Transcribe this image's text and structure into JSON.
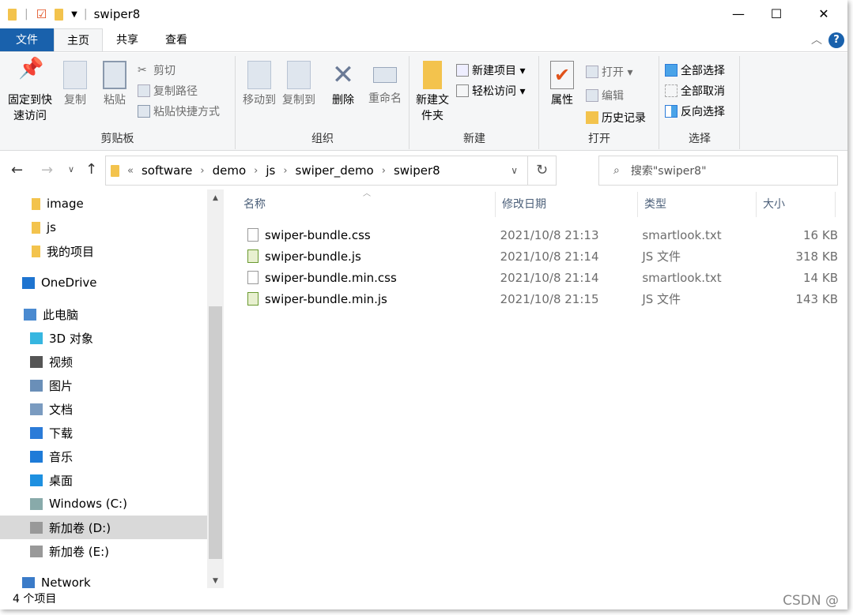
{
  "window": {
    "title": "swiper8",
    "minimize": "—",
    "maximize": "☐",
    "close": "✕"
  },
  "tabs": [
    {
      "label": "文件"
    },
    {
      "label": "主页"
    },
    {
      "label": "共享"
    },
    {
      "label": "查看"
    }
  ],
  "ribbon": {
    "clipboard": {
      "label": "剪贴板",
      "pin": "固定到快速访问",
      "copy": "复制",
      "paste": "粘贴",
      "cut": "剪切",
      "copy_path": "复制路径",
      "paste_shortcut": "粘贴快捷方式"
    },
    "organize": {
      "label": "组织",
      "move_to": "移动到",
      "copy_to": "复制到",
      "delete": "删除",
      "rename": "重命名"
    },
    "new": {
      "label": "新建",
      "new_folder": "新建文件夹",
      "new_item": "新建项目 ▾",
      "easy_access": "轻松访问 ▾"
    },
    "open": {
      "label": "打开",
      "properties": "属性",
      "open": "打开 ▾",
      "edit": "编辑",
      "history": "历史记录"
    },
    "select": {
      "label": "选择",
      "select_all": "全部选择",
      "select_none": "全部取消",
      "invert": "反向选择"
    }
  },
  "address": {
    "prefix": "«",
    "crumbs": [
      "software",
      "demo",
      "js",
      "swiper_demo",
      "swiper8"
    ],
    "search_placeholder": "搜索\"swiper8\""
  },
  "nav": [
    {
      "label": "image",
      "icon": "folder-icon",
      "color": "#f3c34d"
    },
    {
      "label": "js",
      "icon": "folder-icon",
      "color": "#f3c34d"
    },
    {
      "label": "我的项目",
      "icon": "folder-icon",
      "color": "#f3c34d"
    },
    {
      "label": "OneDrive",
      "icon": "cloud-icon",
      "color": "#1e74d0"
    },
    {
      "label": "此电脑",
      "icon": "computer-icon",
      "color": "#4a8ad0"
    },
    {
      "label": "3D 对象",
      "icon": "cube-icon",
      "color": "#36b6e0"
    },
    {
      "label": "视频",
      "icon": "film-icon",
      "color": "#555"
    },
    {
      "label": "图片",
      "icon": "picture-icon",
      "color": "#6a8fb8"
    },
    {
      "label": "文档",
      "icon": "document-icon",
      "color": "#7a9bc0"
    },
    {
      "label": "下载",
      "icon": "download-icon",
      "color": "#2b7bd8"
    },
    {
      "label": "音乐",
      "icon": "music-icon",
      "color": "#1e7bd8"
    },
    {
      "label": "桌面",
      "icon": "desktop-icon",
      "color": "#1e90e0"
    },
    {
      "label": "Windows (C:)",
      "icon": "drive-icon",
      "color": "#8aa"
    },
    {
      "label": "新加卷 (D:)",
      "icon": "drive-icon",
      "color": "#999",
      "selected": true
    },
    {
      "label": "新加卷 (E:)",
      "icon": "drive-icon",
      "color": "#999"
    },
    {
      "label": "Network",
      "icon": "network-icon",
      "color": "#3a7bc8"
    }
  ],
  "columns": [
    "名称",
    "修改日期",
    "类型",
    "大小"
  ],
  "files": [
    {
      "name": "swiper-bundle.css",
      "date": "2021/10/8 21:13",
      "type": "smartlook.txt",
      "size": "16 KB",
      "icon": "text-file-icon"
    },
    {
      "name": "swiper-bundle.js",
      "date": "2021/10/8 21:14",
      "type": "JS 文件",
      "size": "318 KB",
      "icon": "js-file-icon"
    },
    {
      "name": "swiper-bundle.min.css",
      "date": "2021/10/8 21:14",
      "type": "smartlook.txt",
      "size": "14 KB",
      "icon": "text-file-icon"
    },
    {
      "name": "swiper-bundle.min.js",
      "date": "2021/10/8 21:15",
      "type": "JS 文件",
      "size": "143 KB",
      "icon": "js-file-icon"
    }
  ],
  "status": "4 个项目",
  "watermark": "CSDN @"
}
